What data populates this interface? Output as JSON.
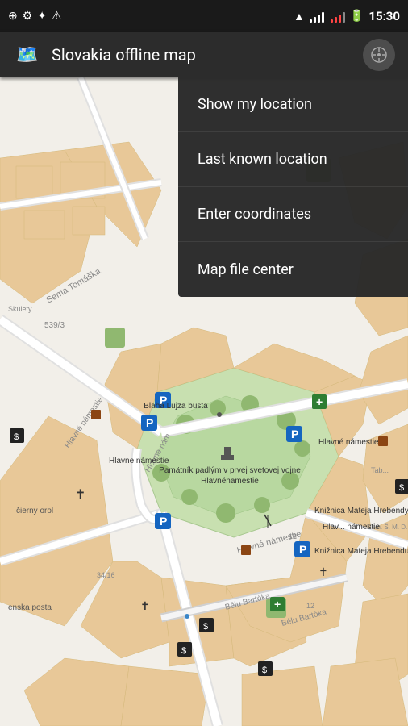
{
  "statusBar": {
    "time": "15:30",
    "icons": [
      "usb",
      "settings",
      "location",
      "warning"
    ]
  },
  "appBar": {
    "title": "Slovakia offline map",
    "logoEmoji": "🗺️",
    "compassLabel": "compass"
  },
  "menu": {
    "items": [
      {
        "id": "show-my-location",
        "label": "Show my location"
      },
      {
        "id": "last-known-location",
        "label": "Last known location"
      },
      {
        "id": "enter-coordinates",
        "label": "Enter coordinates"
      },
      {
        "id": "map-file-center",
        "label": "Map file center"
      }
    ]
  },
  "map": {
    "title": "Slovakia offline map"
  }
}
